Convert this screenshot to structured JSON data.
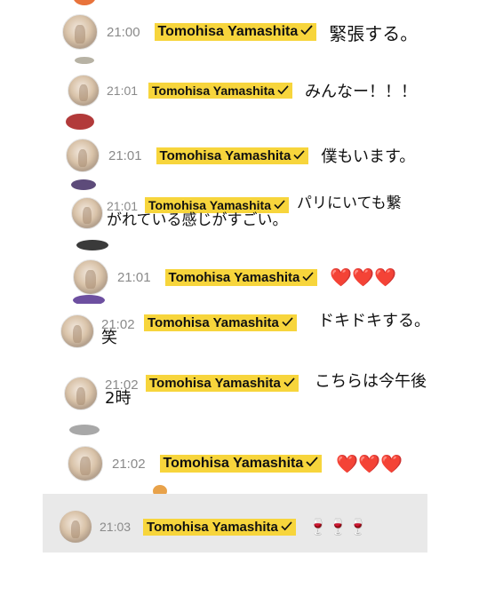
{
  "sender": "Tomohisa Yamashita",
  "check_icon": "checkmark",
  "colors": {
    "badge": "#f7d53c",
    "time": "#8a8a8a",
    "heart": "#d93a2b"
  },
  "messages": [
    {
      "time": "21:00",
      "text": "緊張する。"
    },
    {
      "time": "21:01",
      "text": "みんなー！！！"
    },
    {
      "time": "21:01",
      "text": "僕もいます。"
    },
    {
      "time": "21:01",
      "text": "パリにいても繋",
      "text_line2": "がれている感じがすごい。"
    },
    {
      "time": "21:01",
      "text": "❤️❤️❤️"
    },
    {
      "time": "21:02",
      "text": "ドキドキする。",
      "text_line2": "笑"
    },
    {
      "time": "21:02",
      "text": "こちらは今午後",
      "text_line2": "2時"
    },
    {
      "time": "21:02",
      "text": "❤️❤️❤️"
    },
    {
      "time": "21:03",
      "text": "🍷🍷🍷"
    }
  ]
}
